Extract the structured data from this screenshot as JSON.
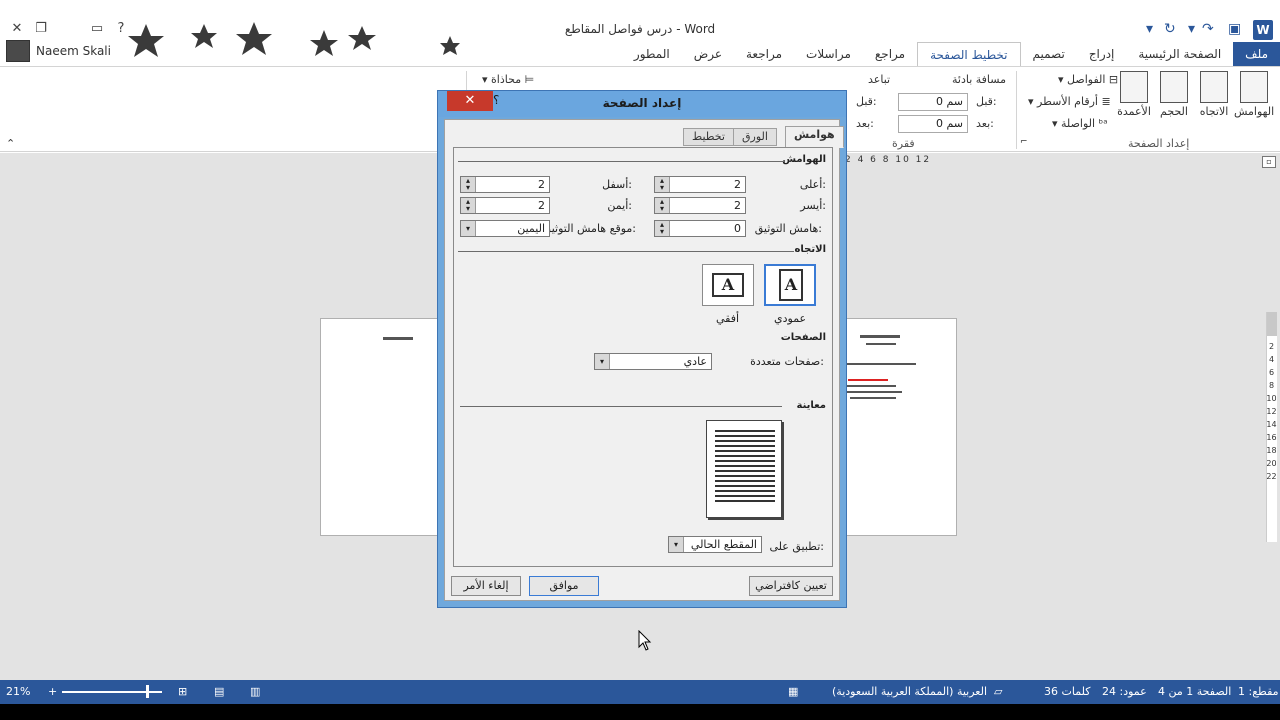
{
  "window": {
    "title": "درس فواصل المقاطع - Word",
    "user_name": "Naeem Skali"
  },
  "ribbon_tabs": [
    {
      "label": "ملف"
    },
    {
      "label": "الصفحة الرئيسية"
    },
    {
      "label": "إدراج"
    },
    {
      "label": "تصميم"
    },
    {
      "label": "تخطيط الصفحة"
    },
    {
      "label": "مراجع"
    },
    {
      "label": "مراسلات"
    },
    {
      "label": "مراجعة"
    },
    {
      "label": "عرض"
    },
    {
      "label": "المطور"
    }
  ],
  "ribbon": {
    "margins": "الهوامش",
    "orientation": "الاتجاه",
    "size": "الحجم",
    "columns": "الأعمدة",
    "breaks": "الفواصل",
    "line_numbers": "أرقام الأسطر",
    "hyphenation": "الواصلة",
    "page_setup_group": "إعداد الصفحة",
    "indent_label": "مسافة بادئة",
    "spacing_label": "تباعد",
    "before_label": "قبل:",
    "after_label": "بعد:",
    "indent_before_value": "0 سم",
    "indent_after_value": "0 سم",
    "paragraph_group": "فقرة",
    "align": "محاذاة"
  },
  "ruler_numbers": "2 4 6 8 10 12",
  "vertical_ruler": [
    "2",
    "4",
    "6",
    "8",
    "10",
    "12",
    "14",
    "16",
    "18",
    "20",
    "22"
  ],
  "dialog": {
    "title": "إعداد الصفحة",
    "help": "؟",
    "close": "✕",
    "tabs": [
      {
        "label": "هوامش"
      },
      {
        "label": "الورق"
      },
      {
        "label": "تخطيط"
      }
    ],
    "margins_section": "الهوامش",
    "top_label": "أعلى:",
    "top_value": "2",
    "bottom_label": "أسفل:",
    "bottom_value": "2",
    "left_label": "أيسر:",
    "left_value": "2",
    "right_label": "أيمن:",
    "right_value": "2",
    "gutter_label": "هامش التوثيق:",
    "gutter_value": "0",
    "gutter_pos_label": "موقع هامش التوثيق:",
    "gutter_pos_value": "اليمين",
    "orientation_section": "الاتجاه",
    "portrait_label": "عمودي",
    "landscape_label": "أفقي",
    "portrait_glyph": "A",
    "landscape_glyph": "A",
    "pages_section": "الصفحات",
    "multiple_pages_label": "صفحات متعددة:",
    "multiple_pages_value": "عادي",
    "preview_section": "معاينة",
    "apply_to_label": "تطبيق على:",
    "apply_to_value": "المقطع الحالي",
    "set_default_button": "تعيين كافتراضي",
    "ok_button": "موافق",
    "cancel_button": "إلغاء الأمر"
  },
  "status": {
    "section": "مقطع: 1",
    "page": "الصفحة 1 من 4",
    "column": "عمود: 24",
    "words": "36 كلمات",
    "language": "العربية (المملكة العربية السعودية)",
    "zoom": "21%"
  }
}
